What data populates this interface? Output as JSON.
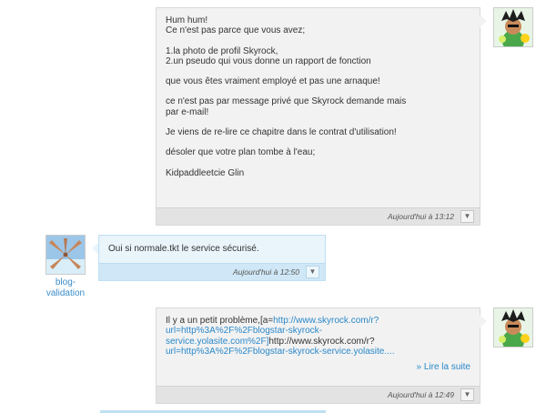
{
  "messages": [
    {
      "lines": [
        "Hum hum!",
        "Ce n'est pas parce que vous avez;",
        "1.la photo de profil Skyrock,",
        "2.un pseudo qui vous donne un rapport de fonction",
        "que vous êtes vraiment employé et pas une arnaque!",
        "ce n'est pas par message privé que Skyrock demande mais",
        "par e-mail!",
        "Je viens de re-lire ce chapitre dans le contrat d'utilisation!",
        "désoler que votre plan tombe à l'eau;",
        "Kidpaddleetcie Glin"
      ],
      "timestamp": "Aujourd'hui à 13:12",
      "menu_icon": "▼"
    },
    {
      "author": "blog-\nvalidation",
      "author_line1": "blog-",
      "author_line2": "validation",
      "text": "Oui si normale.tkt le service sécurisé.",
      "timestamp": "Aujourd'hui à 12:50",
      "menu_icon": "▼"
    },
    {
      "text_prefix": "Il y a un petit problème,[a=",
      "link1": "http://www.skyrock.com/r?",
      "link2": "url=http%3A%2F%2Fblogstar-skyrock-",
      "link3": "service.yolasite.com%2F]",
      "text_mid": "http://www.skyrock.com/r?",
      "link4": "url=http%3A%2F%2Fblogstar-skyrock-service.yolasite....",
      "read_more": "» Lire la suite",
      "timestamp": "Aujourd'hui à 12:49",
      "menu_icon": "▼"
    }
  ],
  "colors": {
    "bubble_gray": "#f2f2f2",
    "bubble_blue": "#e9f4fb",
    "link": "#2a88c9"
  }
}
